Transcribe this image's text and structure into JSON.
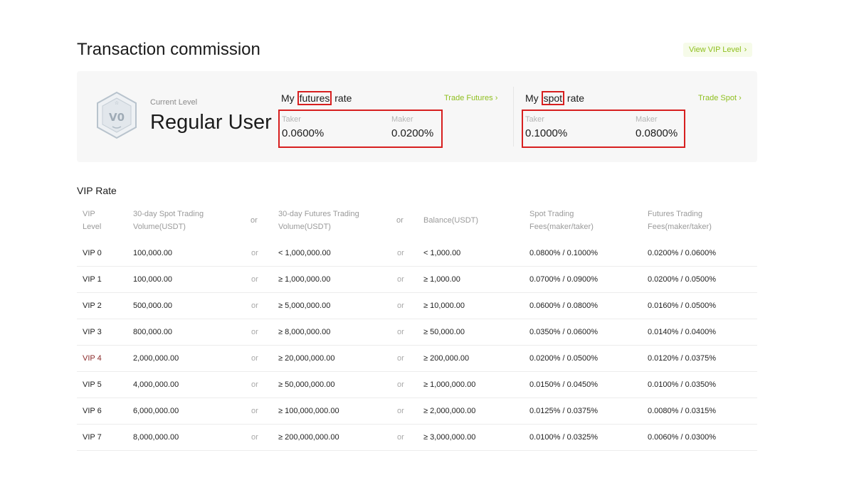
{
  "header": {
    "title": "Transaction commission",
    "view_vip_label": "View VIP Level"
  },
  "level": {
    "badge_text": "V0",
    "caption": "Current Level",
    "name": "Regular User"
  },
  "futures": {
    "title_prefix": "My ",
    "title_highlight": "futures",
    "title_suffix": " rate",
    "trade_label": "Trade Futures",
    "taker_label": "Taker",
    "taker_value": "0.0600%",
    "maker_label": "Maker",
    "maker_value": "0.0200%"
  },
  "spot": {
    "title_prefix": "My ",
    "title_highlight": "spot",
    "title_suffix": " rate",
    "trade_label": "Trade Spot",
    "taker_label": "Taker",
    "taker_value": "0.1000%",
    "maker_label": "Maker",
    "maker_value": "0.0800%"
  },
  "vip_table": {
    "title": "VIP Rate",
    "headers": {
      "level_1": "VIP",
      "level_2": "Level",
      "spot_vol_1": "30-day Spot Trading",
      "spot_vol_2": "Volume(USDT)",
      "or": "or",
      "fut_vol_1": "30-day Futures Trading",
      "fut_vol_2": "Volume(USDT)",
      "balance": "Balance(USDT)",
      "spot_fee_1": "Spot Trading",
      "spot_fee_2": "Fees(maker/taker)",
      "fut_fee_1": "Futures Trading",
      "fut_fee_2": "Fees(maker/taker)"
    },
    "rows": [
      {
        "level": "VIP 0",
        "spot_vol": "100,000.00",
        "or1": "or",
        "fut_vol": "< 1,000,000.00",
        "or2": "or",
        "balance": "< 1,000.00",
        "spot_fee": "0.0800% / 0.1000%",
        "fut_fee": "0.0200% / 0.0600%"
      },
      {
        "level": "VIP 1",
        "spot_vol": "100,000.00",
        "or1": "or",
        "fut_vol": "≥ 1,000,000.00",
        "or2": "or",
        "balance": "≥ 1,000.00",
        "spot_fee": "0.0700% / 0.0900%",
        "fut_fee": "0.0200% / 0.0500%"
      },
      {
        "level": "VIP 2",
        "spot_vol": "500,000.00",
        "or1": "or",
        "fut_vol": "≥ 5,000,000.00",
        "or2": "or",
        "balance": "≥ 10,000.00",
        "spot_fee": "0.0600% / 0.0800%",
        "fut_fee": "0.0160% / 0.0500%"
      },
      {
        "level": "VIP 3",
        "spot_vol": "800,000.00",
        "or1": "or",
        "fut_vol": "≥ 8,000,000.00",
        "or2": "or",
        "balance": "≥ 50,000.00",
        "spot_fee": "0.0350% / 0.0600%",
        "fut_fee": "0.0140% / 0.0400%"
      },
      {
        "level": "VIP 4",
        "spot_vol": "2,000,000.00",
        "or1": "or",
        "fut_vol": "≥ 20,000,000.00",
        "or2": "or",
        "balance": "≥ 200,000.00",
        "spot_fee": "0.0200% / 0.0500%",
        "fut_fee": "0.0120% / 0.0375%"
      },
      {
        "level": "VIP 5",
        "spot_vol": "4,000,000.00",
        "or1": "or",
        "fut_vol": "≥ 50,000,000.00",
        "or2": "or",
        "balance": "≥ 1,000,000.00",
        "spot_fee": "0.0150% / 0.0450%",
        "fut_fee": "0.0100% / 0.0350%"
      },
      {
        "level": "VIP 6",
        "spot_vol": "6,000,000.00",
        "or1": "or",
        "fut_vol": "≥ 100,000,000.00",
        "or2": "or",
        "balance": "≥ 2,000,000.00",
        "spot_fee": "0.0125% / 0.0375%",
        "fut_fee": "0.0080% / 0.0315%"
      },
      {
        "level": "VIP 7",
        "spot_vol": "8,000,000.00",
        "or1": "or",
        "fut_vol": "≥ 200,000,000.00",
        "or2": "or",
        "balance": "≥ 3,000,000.00",
        "spot_fee": "0.0100% / 0.0325%",
        "fut_fee": "0.0060% / 0.0300%"
      }
    ]
  },
  "colors": {
    "accent": "#8fbf1f",
    "highlight_box": "#d71f1f",
    "panel_bg": "#f7f7f7"
  }
}
